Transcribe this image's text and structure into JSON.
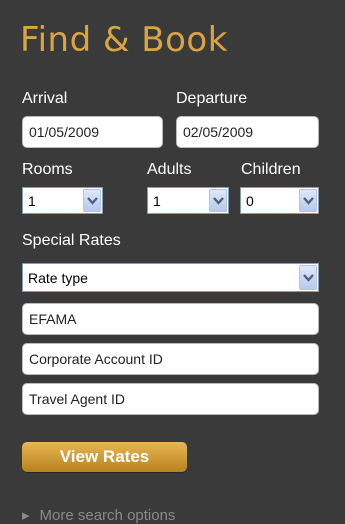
{
  "header": {
    "title": "Find & Book"
  },
  "dates": {
    "arrival_label": "Arrival",
    "arrival_value": "01/05/2009",
    "departure_label": "Departure",
    "departure_value": "02/05/2009"
  },
  "occupancy": {
    "rooms_label": "Rooms",
    "rooms_value": "1",
    "adults_label": "Adults",
    "adults_value": "1",
    "children_label": "Children",
    "children_value": "0"
  },
  "special_rates": {
    "label": "Special Rates",
    "rate_type_value": "Rate type",
    "efama_value": "EFAMA",
    "corporate_placeholder": "Corporate Account ID",
    "travel_agent_placeholder": "Travel Agent ID"
  },
  "actions": {
    "view_rates_label": "View Rates",
    "more_options_label": "More search options"
  },
  "colors": {
    "background": "#3a3a3a",
    "title": "#d9a441",
    "button": "#d4a03a"
  },
  "icons": {
    "dropdown": "chevron-down-icon"
  }
}
